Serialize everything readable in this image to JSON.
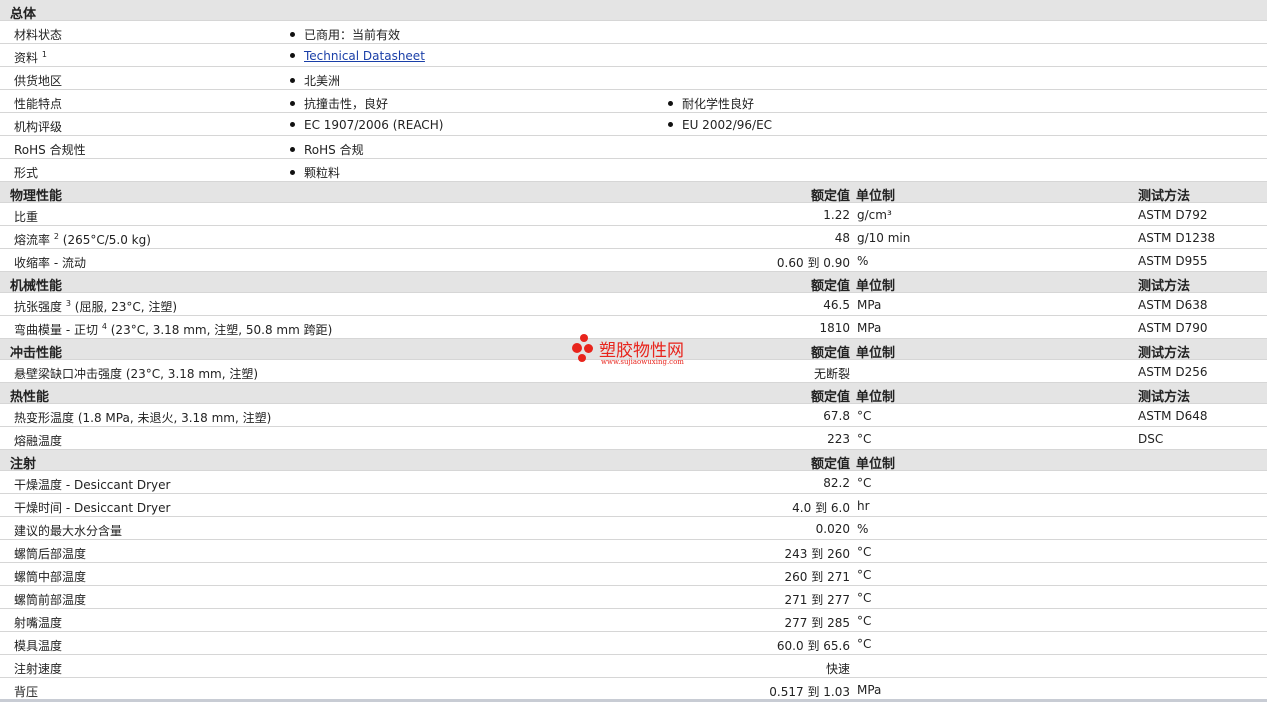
{
  "general": {
    "title": "总体",
    "rows": [
      {
        "label": "材料状态",
        "col1": "已商用：当前有效"
      },
      {
        "label": "资料",
        "sup": "1",
        "link": "Technical Datasheet"
      },
      {
        "label": "供货地区",
        "col1": "北美洲"
      },
      {
        "label": "性能特点",
        "col1": "抗撞击性，良好",
        "col2": "耐化学性良好"
      },
      {
        "label": "机构评级",
        "col1": "EC 1907/2006 (REACH)",
        "col2": "EU 2002/96/EC"
      },
      {
        "label": "RoHS 合规性",
        "col1": "RoHS 合规"
      },
      {
        "label": "形式",
        "col1": "颗粒料"
      }
    ]
  },
  "column_headers": {
    "value": "额定值",
    "unit": "单位制",
    "test": "测试方法"
  },
  "sections": [
    {
      "title": "物理性能",
      "show_test_header": true,
      "rows": [
        {
          "label": "比重",
          "value": "1.22",
          "unit": "g/cm³",
          "test": "ASTM D792"
        },
        {
          "label": "熔流率",
          "sup": "2",
          "cond": "(265°C/5.0 kg)",
          "value": "48",
          "unit": "g/10 min",
          "test": "ASTM D1238"
        },
        {
          "label": "收缩率",
          "cond": "- 流动",
          "v1": "0.60",
          "to": "到",
          "v2": "0.90",
          "unit": "%",
          "test": "ASTM D955"
        }
      ]
    },
    {
      "title": "机械性能",
      "show_test_header": true,
      "rows": [
        {
          "label": "抗张强度",
          "sup": "3",
          "cond": "(屈服, 23°C, 注塑)",
          "value": "46.5",
          "unit": "MPa",
          "test": "ASTM D638"
        },
        {
          "label": "弯曲模量",
          "cond": "- 正切",
          "sup2": "4",
          "cond2": "(23°C, 3.18 mm, 注塑, 50.8 mm 跨距)",
          "value": "1810",
          "unit": "MPa",
          "test": "ASTM D790"
        }
      ]
    },
    {
      "title": "冲击性能",
      "show_test_header": true,
      "rows": [
        {
          "label": "悬壁梁缺口冲击强度",
          "cond": "(23°C, 3.18 mm, 注塑)",
          "value": "无断裂",
          "unit": "",
          "test": "ASTM D256"
        }
      ]
    },
    {
      "title": "热性能",
      "show_test_header": true,
      "rows": [
        {
          "label": "热变形温度",
          "cond": "(1.8 MPa, 未退火, 3.18 mm, 注塑)",
          "value": "67.8",
          "unit": "°C",
          "test": "ASTM D648"
        },
        {
          "label": "熔融温度",
          "value": "223",
          "unit": "°C",
          "test": "DSC"
        }
      ]
    },
    {
      "title": "注射",
      "show_test_header": false,
      "rows": [
        {
          "label": "干燥温度",
          "cond": "- Desiccant Dryer",
          "value": "82.2",
          "unit": "°C"
        },
        {
          "label": "干燥时间",
          "cond": "- Desiccant Dryer",
          "v1": "4.0",
          "to": "到",
          "v2": "6.0",
          "unit": "hr"
        },
        {
          "label": "建议的最大水分含量",
          "value": "0.020",
          "unit": "%"
        },
        {
          "label": "螺筒后部温度",
          "v1": "243",
          "to": "到",
          "v2": "260",
          "unit": "°C"
        },
        {
          "label": "螺筒中部温度",
          "v1": "260",
          "to": "到",
          "v2": "271",
          "unit": "°C"
        },
        {
          "label": "螺筒前部温度",
          "v1": "271",
          "to": "到",
          "v2": "277",
          "unit": "°C"
        },
        {
          "label": "射嘴温度",
          "v1": "277",
          "to": "到",
          "v2": "285",
          "unit": "°C"
        },
        {
          "label": "模具温度",
          "v1": "60.0",
          "to": "到",
          "v2": "65.6",
          "unit": "°C"
        },
        {
          "label": "注射速度",
          "value": "快速",
          "unit": ""
        },
        {
          "label": "背压",
          "v1": "0.517",
          "to": "到",
          "v2": "1.03",
          "unit": "MPa"
        }
      ]
    }
  ],
  "watermark": {
    "text": "塑胶物性网",
    "url": "www.sujiaowuxing.com"
  },
  "colors": {
    "header_bg": "#e4e4e4",
    "row_border": "#d6d6d6",
    "link": "#1a3fa8",
    "watermark": "#e8241c"
  }
}
